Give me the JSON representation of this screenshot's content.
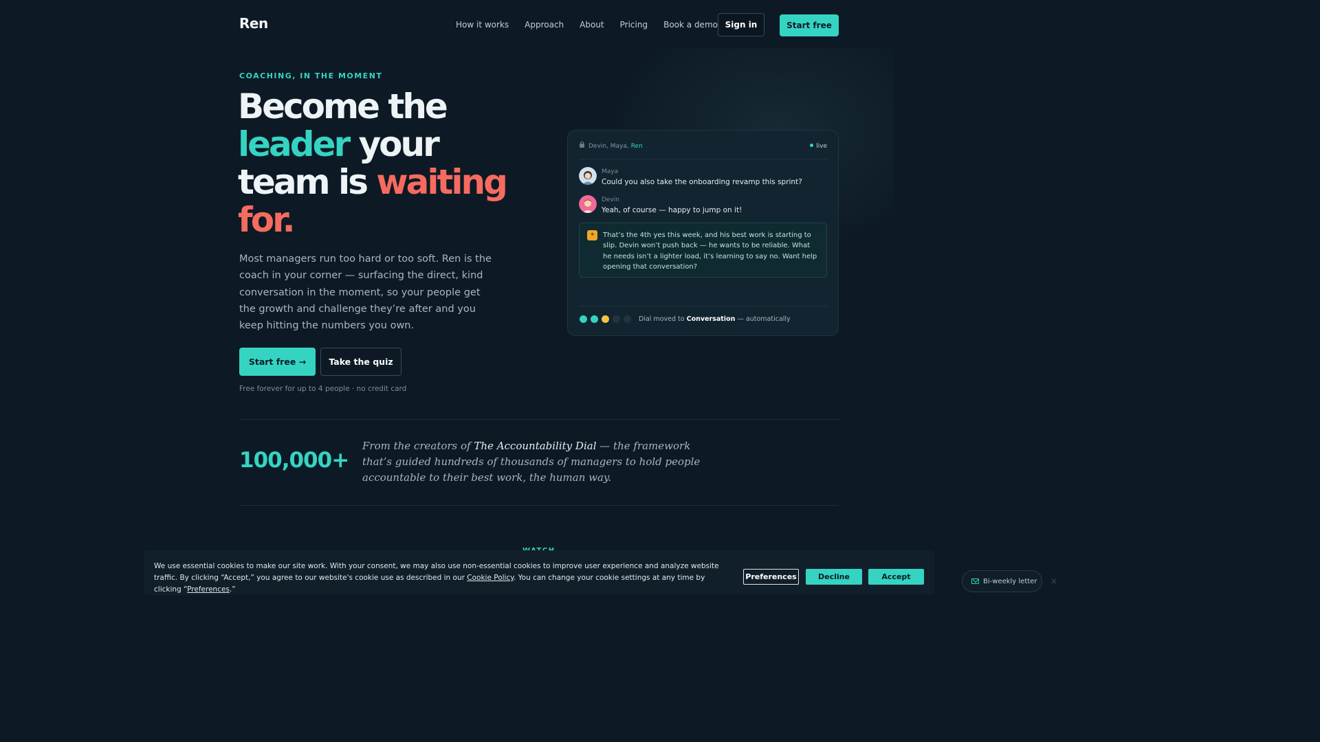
{
  "brand": {
    "name": "Ren"
  },
  "nav": {
    "links": [
      "How it works",
      "Approach",
      "About",
      "Pricing",
      "Book a demo"
    ],
    "signin_label": "Sign in",
    "startfree_label": "Start free"
  },
  "hero": {
    "eyebrow": "COACHING, IN THE MOMENT",
    "headline": {
      "part1": "Become the",
      "part2": "leader",
      "part3": "your",
      "part4": "team is",
      "part5": "waiting",
      "part6": "for."
    },
    "lead": "Most managers run too hard or too soft. Ren is the coach in your corner — surfacing the direct, kind conversation in the moment, so your people get the growth and challenge they’re after and you keep hitting the numbers you own.",
    "cta_primary": "Start free →",
    "cta_secondary": "Take the quiz",
    "fine_print": "Free forever for up to 4 people · no credit card"
  },
  "chat": {
    "participants": "Devin, Maya,",
    "ren_participant": "Ren",
    "status": "live",
    "messages": [
      {
        "author": "Maya",
        "text": "Could you also take the onboarding revamp this sprint?"
      },
      {
        "author": "Devin",
        "text": "Yeah, of course — happy to jump on it!"
      }
    ],
    "ren_note": "That’s the 4th yes this week, and his best work is starting to slip. Devin won’t push back — he wants to be reliable. What he needs isn’t a lighter load, it’s learning to say no. Want help opening that conversation?",
    "dial": {
      "prefix": "Dial moved to",
      "target": "Conversation",
      "suffix": "— automatically",
      "dots": [
        "#35d4c2",
        "#35d4c2",
        "#f5c542",
        "#24343f",
        "#24343f"
      ]
    }
  },
  "stats": {
    "number": "100,000+",
    "quote_pre": "From the creators of",
    "quote_title": "The Accountability Dial",
    "quote_post": "— the framework that’s guided hundreds of thousands of managers to hold people accountable to their best work, the human way."
  },
  "watch_label": "WATCH",
  "cookie": {
    "text_pre": "We use essential cookies to make our site work. With your consent, we may also use non-essential cookies to improve user experience and analyze website traffic. By clicking “Accept,” you agree to our website's cookie use as described in our",
    "policy_link": "Cookie Policy",
    "text_mid": ". You can change your cookie settings at any time by clicking “",
    "pref_link": "Preferences",
    "text_end": ".”",
    "btn_preferences": "Preferences",
    "btn_decline": "Decline",
    "btn_accept": "Accept"
  },
  "newsletter": {
    "label": "Bi-weekly letter",
    "close": "×"
  },
  "colors": {
    "accent": "#35d4c2",
    "coral": "#f66b5f",
    "background": "#0d1a25"
  }
}
